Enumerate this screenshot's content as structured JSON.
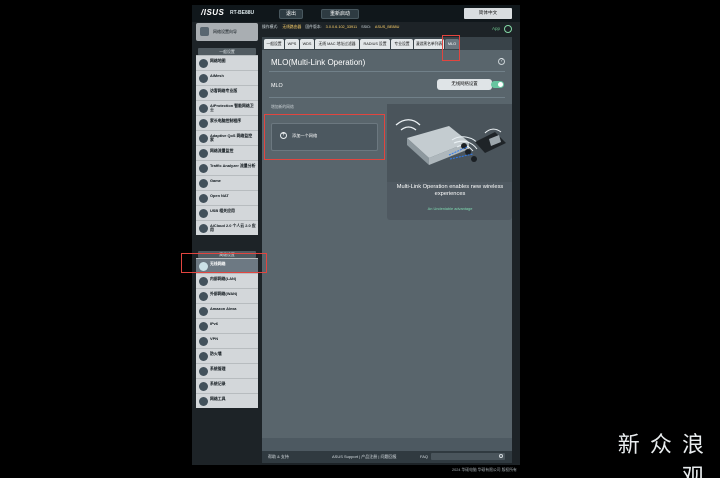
{
  "header": {
    "logo": "/ISUS",
    "model": "RT-BE88U",
    "buttons": [
      "退出",
      "重新启动"
    ],
    "language": "简体中文"
  },
  "status": {
    "label_mode": "操作模式:",
    "mode_value": "无线路由器",
    "label_firmware": "固件版本:",
    "firmware_value": "3.0.0.6.102_33911",
    "label_ssid": "SSID:",
    "ssid_value": "ASUS_BE88U",
    "app_label": "App"
  },
  "sidebar": {
    "quick": "网络设置向导",
    "general_header": "一般设置",
    "general_items": [
      "网络地图",
      "AiMesh",
      "访客网络专业版",
      "AiProtection 智能网络卫士",
      "家长电脑控制程序",
      "Adaptive QoS 网络监控家",
      "网络流量监控",
      "Traffic Analyzer 流量分析",
      "Game",
      "Open NAT",
      "USB 相关应用",
      "AiCloud 2.0 个人云 2.0 应用"
    ],
    "advanced_header": "高级设置",
    "advanced_items": [
      "无线网络",
      "内部网络(LAN)",
      "外部网络(WAN)",
      "Amazon Alexa",
      "IPv6",
      "VPN",
      "防火墙",
      "系统管理",
      "系统记录",
      "网络工具"
    ]
  },
  "tabs": [
    "一般设置",
    "WPS",
    "WDS",
    "无线 MAC 地址过滤器",
    "RADIUS 设置",
    "专业设置",
    "漫游黑名单列表",
    "MLO"
  ],
  "panel": {
    "title": "MLO(Multi-Link Operation)",
    "help_glyph": "?",
    "mlo_label": "MLO",
    "settings_button": "无线网络设置",
    "section_label": "增加新的网络",
    "add_network": "添加一个网络",
    "card_title": "Multi-Link Operation enables new wireless experiences",
    "card_subtitle": "An Undeniable advantage"
  },
  "footer": {
    "help": "帮助 & 支持",
    "links": "ASUS Support | 产品注册 | 问题回报",
    "faq": "FAQ",
    "copyright": "2024 华硕电脑 华硕有限公司 版权所有"
  },
  "watermark": "新 众 浪 观",
  "colors": {
    "accent_green": "#67c5a0",
    "highlight_red": "#e2453f",
    "panel": "#59656c"
  }
}
